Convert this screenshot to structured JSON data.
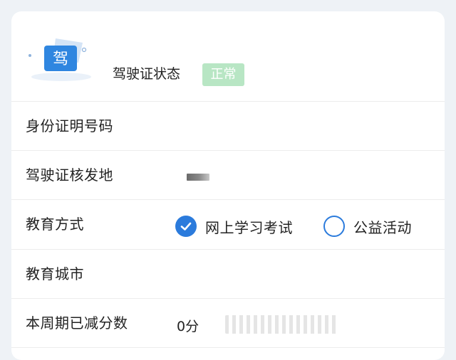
{
  "license": {
    "icon_char": "驾",
    "status_label": "驾驶证状态",
    "status_value": "正常"
  },
  "rows": {
    "id_number": {
      "label": "身份证明号码"
    },
    "issue_place": {
      "label": "驾驶证核发地"
    },
    "education_method": {
      "label": "教育方式",
      "options": [
        {
          "label": "网上学习考试",
          "selected": true
        },
        {
          "label": "公益活动",
          "selected": false
        }
      ]
    },
    "education_city": {
      "label": "教育城市"
    },
    "score_reduced": {
      "label": "本周期已减分数",
      "value": "0分"
    }
  },
  "colors": {
    "accent": "#2b7bdc",
    "badge_bg": "#b8e6c4",
    "page_bg": "#eef2f6"
  },
  "icons": {
    "license": "driver-license-icon",
    "check": "check-icon"
  }
}
